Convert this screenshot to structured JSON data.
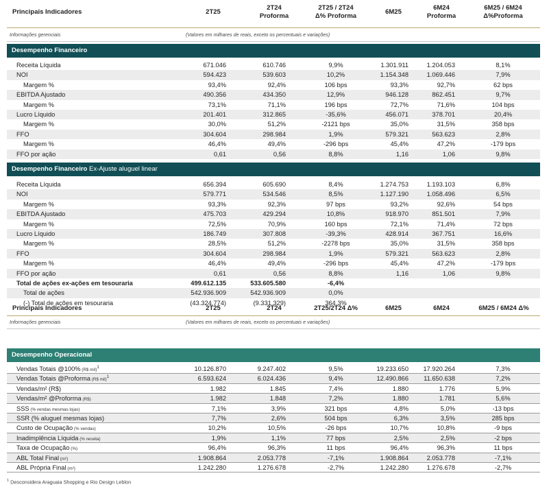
{
  "header1": {
    "label": "Principais Indicadores",
    "cols": [
      {
        "l1": "2T25",
        "l2": ""
      },
      {
        "l1": "2T24",
        "l2": "Proforma"
      },
      {
        "l1": "2T25 / 2T24",
        "l2": "Δ% Proforma"
      },
      {
        "l1": "6M25",
        "l2": ""
      },
      {
        "l1": "6M24",
        "l2": "Proforma"
      },
      {
        "l1": "6M25 / 6M24",
        "l2": "Δ%Proforma"
      }
    ]
  },
  "info1": {
    "left": "Informações gerenciais",
    "center": "(Valores em milhares de reais, exceto os percentuais e variações)"
  },
  "section1": {
    "title": "Desempenho Financeiro",
    "rows": [
      {
        "label": "Receita Líquida",
        "indent": false,
        "v": [
          "671.046",
          "610.746",
          "9,9%",
          "1.301.911",
          "1.204.053",
          "8,1%"
        ]
      },
      {
        "label": "NOI",
        "indent": false,
        "v": [
          "594.423",
          "539.603",
          "10,2%",
          "1.154.348",
          "1.069.446",
          "7,9%"
        ]
      },
      {
        "label": "Margem %",
        "indent": true,
        "v": [
          "93,4%",
          "92,4%",
          "106 bps",
          "93,3%",
          "92,7%",
          "62 bps"
        ]
      },
      {
        "label": "EBITDA Ajustado",
        "indent": false,
        "v": [
          "490.356",
          "434.350",
          "12,9%",
          "946.128",
          "862.451",
          "9,7%"
        ]
      },
      {
        "label": "Margem %",
        "indent": true,
        "v": [
          "73,1%",
          "71,1%",
          "196 bps",
          "72,7%",
          "71,6%",
          "104 bps"
        ]
      },
      {
        "label": "Lucro Líquido",
        "indent": false,
        "v": [
          "201.401",
          "312.865",
          "-35,6%",
          "456.071",
          "378.701",
          "20,4%"
        ]
      },
      {
        "label": "Margem %",
        "indent": true,
        "v": [
          "30,0%",
          "51,2%",
          "-2121 bps",
          "35,0%",
          "31,5%",
          "358 bps"
        ]
      },
      {
        "label": "FFO",
        "indent": false,
        "v": [
          "304.604",
          "298.984",
          "1,9%",
          "579.321",
          "563.623",
          "2,8%"
        ]
      },
      {
        "label": "Margem %",
        "indent": true,
        "v": [
          "46,4%",
          "49,4%",
          "-296 bps",
          "45,4%",
          "47,2%",
          "-179 bps"
        ]
      },
      {
        "label": "FFO por ação",
        "indent": false,
        "v": [
          "0,61",
          "0,56",
          "8,8%",
          "1,16",
          "1,06",
          "9,8%"
        ]
      }
    ]
  },
  "section2": {
    "title": "Desempenho Financeiro",
    "subtitle": " Ex-Ajuste aluguel linear",
    "rows": [
      {
        "label": "Receita Líquida",
        "indent": false,
        "bold": false,
        "v": [
          "656.394",
          "605.690",
          "8,4%",
          "1.274.753",
          "1.193.103",
          "6,8%"
        ]
      },
      {
        "label": "NOI",
        "indent": false,
        "bold": false,
        "v": [
          "579.771",
          "534.546",
          "8,5%",
          "1.127.190",
          "1.058.496",
          "6,5%"
        ]
      },
      {
        "label": "Margem %",
        "indent": true,
        "bold": false,
        "v": [
          "93,3%",
          "92,3%",
          "97 bps",
          "93,2%",
          "92,6%",
          "54 bps"
        ]
      },
      {
        "label": "EBITDA Ajustado",
        "indent": false,
        "bold": false,
        "v": [
          "475.703",
          "429.294",
          "10,8%",
          "918.970",
          "851.501",
          "7,9%"
        ]
      },
      {
        "label": "Margem %",
        "indent": true,
        "bold": false,
        "v": [
          "72,5%",
          "70,9%",
          "160 bps",
          "72,1%",
          "71,4%",
          "72 bps"
        ]
      },
      {
        "label": "Lucro Líquido",
        "indent": false,
        "bold": false,
        "v": [
          "186.749",
          "307.808",
          "-39,3%",
          "428.914",
          "367.751",
          "16,6%"
        ]
      },
      {
        "label": "Margem %",
        "indent": true,
        "bold": false,
        "v": [
          "28,5%",
          "51,2%",
          "-2278 bps",
          "35,0%",
          "31,5%",
          "358 bps"
        ]
      },
      {
        "label": "FFO",
        "indent": false,
        "bold": false,
        "v": [
          "304.604",
          "298.984",
          "1,9%",
          "579.321",
          "563.623",
          "2,8%"
        ]
      },
      {
        "label": "Margem %",
        "indent": true,
        "bold": false,
        "v": [
          "46,4%",
          "49,4%",
          "-296 bps",
          "45,4%",
          "47,2%",
          "-179 bps"
        ]
      },
      {
        "label": "FFO por ação",
        "indent": false,
        "bold": false,
        "v": [
          "0,61",
          "0,56",
          "8,8%",
          "1,16",
          "1,06",
          "9,8%"
        ]
      },
      {
        "label": "Total de ações ex-ações em tesouraria",
        "indent": false,
        "bold": true,
        "v": [
          "499.612.135",
          "533.605.580",
          "-6,4%",
          "",
          "",
          ""
        ]
      },
      {
        "label": "Total de ações",
        "indent": true,
        "bold": false,
        "v": [
          "542.936.909",
          "542.936.909",
          "0,0%",
          "",
          "",
          ""
        ]
      },
      {
        "label": "(-) Total de ações em tesouraria",
        "indent": true,
        "bold": false,
        "v": [
          "(43.324.774)",
          "(9.331.329)",
          "364,3%",
          "",
          "",
          ""
        ]
      }
    ]
  },
  "header2": {
    "label": "Principais Indicadores",
    "cols": [
      "2T25",
      "2T24",
      "2T25/2T24 Δ%",
      "6M25",
      "6M24",
      "6M25 / 6M24 Δ%"
    ]
  },
  "info2": {
    "left": "Informações gerenciais",
    "center": "(Valores em milhares de reais, exceto os percentuais e variações)"
  },
  "section3": {
    "title": "Desempenho Operacional",
    "rows": [
      {
        "label": "Vendas Totais @100%",
        "note": " (R$ mil)",
        "sup": "1",
        "v": [
          "10.126.870",
          "9.247.402",
          "9,5%",
          "19.233.650",
          "17.920.264",
          "7,3%"
        ]
      },
      {
        "label": "Vendas Totais @Proforma",
        "note": " (R$ mil)",
        "sup": "1",
        "v": [
          "6.593.624",
          "6.024.436",
          "9,4%",
          "12.490.866",
          "11.650.638",
          "7,2%"
        ]
      },
      {
        "label": "Vendas/m² (R$)",
        "note": "",
        "sup": "",
        "v": [
          "1.982",
          "1.845",
          "7,4%",
          "1.880",
          "1.776",
          "5,9%"
        ]
      },
      {
        "label": "Vendas/m² @Proforma",
        "note": " (R$)",
        "sup": "",
        "v": [
          "1.982",
          "1.848",
          "7,2%",
          "1.880",
          "1.781",
          "5,6%"
        ]
      },
      {
        "label": "SSS",
        "note": " (% vendas mesmas lojas)",
        "sup": "",
        "v": [
          "7,1%",
          "3,9%",
          "321 bps",
          "4,8%",
          "5,0%",
          "-13 bps"
        ]
      },
      {
        "label": "SSR (% aluguel mesmas lojas)",
        "note": "",
        "sup": "",
        "v": [
          "7,7%",
          "2,6%",
          "504 bps",
          "6,3%",
          "3,5%",
          "285 bps"
        ]
      },
      {
        "label": "Custo de Ocupação",
        "note": " (% vendas)",
        "sup": "",
        "v": [
          "10,2%",
          "10,5%",
          "-26 bps",
          "10,7%",
          "10,8%",
          "-9 bps"
        ]
      },
      {
        "label": "Inadimplência Líquida",
        "note": " (% receita)",
        "sup": "",
        "v": [
          "1,9%",
          "1,1%",
          "77 bps",
          "2,5%",
          "2,5%",
          "-2 bps"
        ]
      },
      {
        "label": "Taxa de Ocupação",
        "note": " (%)",
        "sup": "",
        "v": [
          "96,4%",
          "96,3%",
          "11 bps",
          "96,4%",
          "96,3%",
          "11 bps"
        ]
      },
      {
        "label": "ABL Total Final",
        "note": " (m²)",
        "sup": "",
        "v": [
          "1.908.864",
          "2.053.778",
          "-7,1%",
          "1.908.864",
          "2.053.778",
          "-7,1%"
        ]
      },
      {
        "label": "ABL Própria Final",
        "note": " (m²)",
        "sup": "",
        "v": [
          "1.242.280",
          "1.276.678",
          "-2,7%",
          "1.242.280",
          "1.276.678",
          "-2,7%"
        ]
      }
    ]
  },
  "footnote": {
    "sup": "1",
    "text": " Desconsidera Araguaia Shopping e Rio Design Leblon"
  }
}
